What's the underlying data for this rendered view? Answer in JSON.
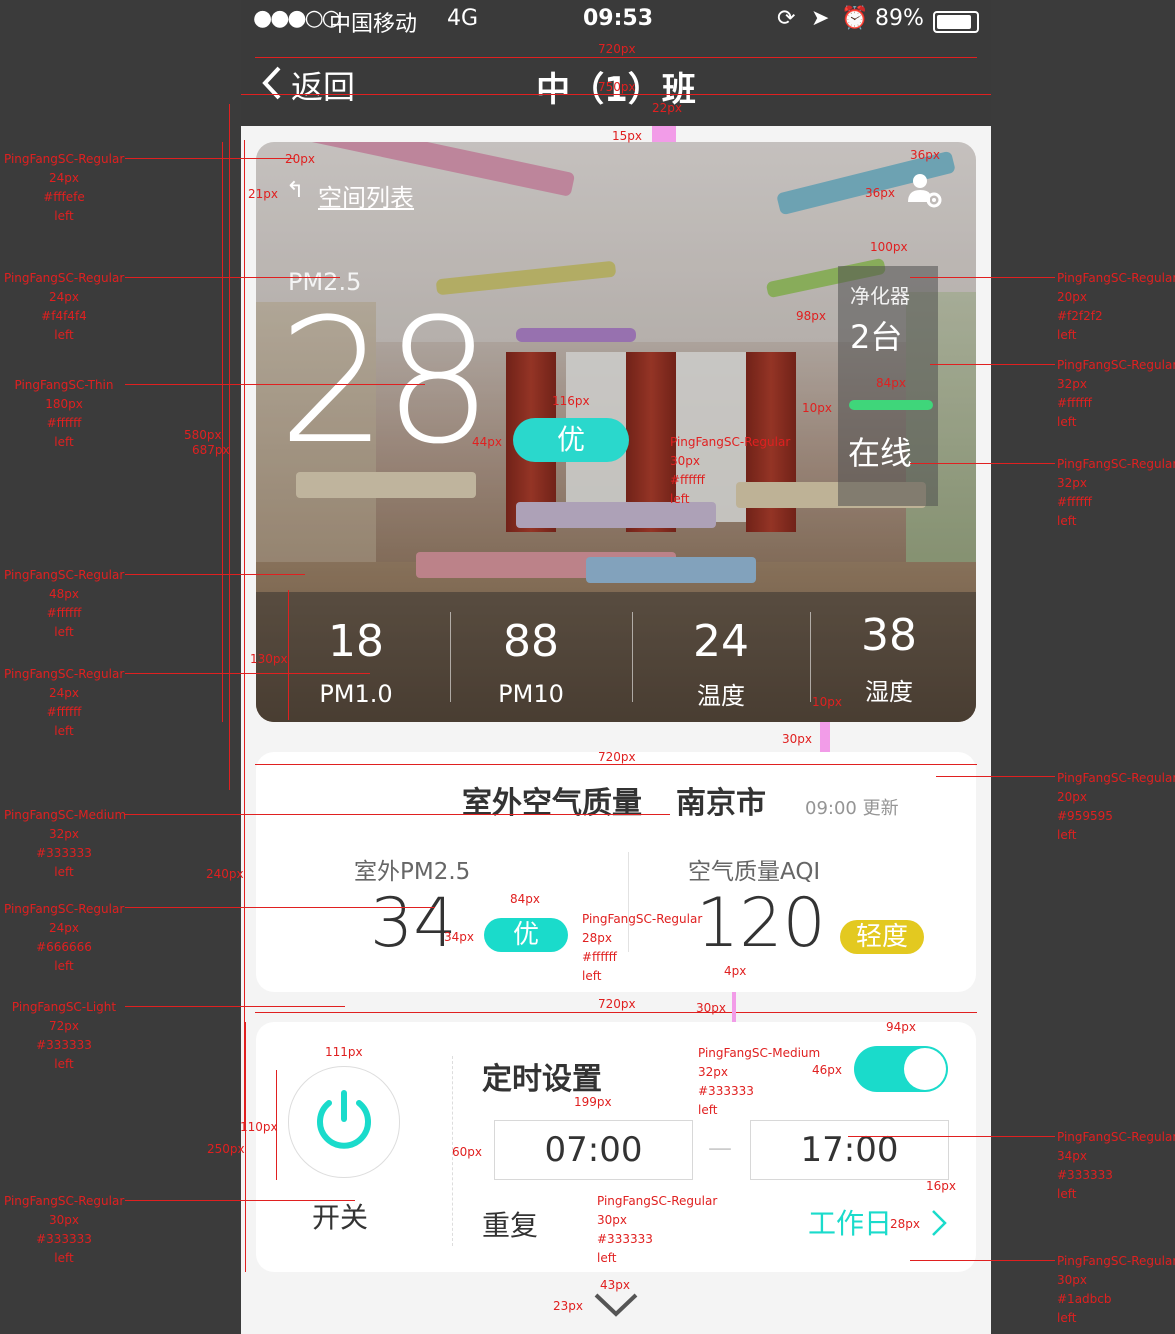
{
  "status_bar": {
    "signal": "●●●○○",
    "carrier": "中国移动",
    "network": "4G",
    "time": "09:53",
    "battery": "89%"
  },
  "nav": {
    "back_label": "返回",
    "title": "中（1）班"
  },
  "hero": {
    "space_list_label": "空间列表",
    "pm25_label": "PM2.5",
    "pm25_value": "28",
    "quality_badge": "优",
    "purifier_label": "净化器",
    "purifier_count": "2台",
    "purifier_status": "在线",
    "metrics": [
      {
        "value": "18",
        "label": "PM1.0"
      },
      {
        "value": "88",
        "label": "PM10"
      },
      {
        "value": "24",
        "label": "温度"
      },
      {
        "value": "38",
        "label": "湿度"
      }
    ]
  },
  "outdoor": {
    "title": "室外空气质量",
    "city": "南京市",
    "updated": "09:00 更新",
    "pm25_label": "室外PM2.5",
    "pm25_value": "34",
    "pm25_badge": "优",
    "aqi_label": "空气质量AQI",
    "aqi_value": "120",
    "aqi_badge": "轻度",
    "colors": {
      "good": "#1adbcb",
      "light": "#e3c920"
    }
  },
  "timer": {
    "power_label": "开关",
    "title": "定时设置",
    "toggle_on": true,
    "start_time": "07:00",
    "separator": "—",
    "end_time": "17:00",
    "repeat_label": "重复",
    "repeat_value": "工作日",
    "accent": "#1adbcb"
  },
  "annotations": {
    "widths": {
      "w720a": "720px",
      "w750": "750px",
      "w22": "22px",
      "w15": "15px",
      "w20": "20px",
      "w21": "21px",
      "w36a": "36px",
      "w36b": "36px",
      "w100": "100px",
      "w98": "98px",
      "w84a": "84px",
      "w10a": "10px",
      "w116": "116px",
      "w44": "44px",
      "w580": "580px",
      "w687": "687px",
      "w130": "130px",
      "w10b": "10px",
      "w30a": "30px",
      "w720b": "720px",
      "w240": "240px",
      "w84b": "84px",
      "w34": "34px",
      "w4": "4px",
      "w720c": "720px",
      "w30b": "30px",
      "w94": "94px",
      "w46": "46px",
      "w111": "111px",
      "w199": "199px",
      "w110": "110px",
      "w250": "250px",
      "w60": "60px",
      "w16": "16px",
      "w28": "28px",
      "w43": "43px",
      "w23": "23px"
    },
    "left_specs": [
      {
        "font": "PingFangSC-Regular",
        "size": "24px",
        "color": "#fffefe",
        "align": "left"
      },
      {
        "font": "PingFangSC-Regular",
        "size": "24px",
        "color": "#f4f4f4",
        "align": "left"
      },
      {
        "font": "PingFangSC-Thin",
        "size": "180px",
        "color": "#ffffff",
        "align": "left"
      },
      {
        "font": "PingFangSC-Regular",
        "size": "48px",
        "color": "#ffffff",
        "align": "left"
      },
      {
        "font": "PingFangSC-Regular",
        "size": "24px",
        "color": "#ffffff",
        "align": "left"
      },
      {
        "font": "PingFangSC-Medium",
        "size": "32px",
        "color": "#333333",
        "align": "left"
      },
      {
        "font": "PingFangSC-Regular",
        "size": "24px",
        "color": "#666666",
        "align": "left"
      },
      {
        "font": "PingFangSC-Light",
        "size": "72px",
        "color": "#333333",
        "align": "left"
      },
      {
        "font": "PingFangSC-Regular",
        "size": "30px",
        "color": "#333333",
        "align": "left"
      }
    ],
    "right_specs": [
      {
        "font": "PingFangSC-Regular",
        "size": "20px",
        "color": "#f2f2f2",
        "align": "left"
      },
      {
        "font": "PingFangSC-Regular",
        "size": "32px",
        "color": "#ffffff",
        "align": "left"
      },
      {
        "font": "PingFangSC-Regular",
        "size": "32px",
        "color": "#ffffff",
        "align": "left"
      },
      {
        "font": "PingFangSC-Regular",
        "size": "20px",
        "color": "#959595",
        "align": "left"
      },
      {
        "font": "PingFangSC-Regular",
        "size": "34px",
        "color": "#333333",
        "align": "left"
      },
      {
        "font": "PingFangSC-Regular",
        "size": "30px",
        "color": "#1adbcb",
        "align": "left"
      }
    ],
    "inline_specs": [
      {
        "font": "PingFangSC-Regular",
        "size": "30px",
        "color": "#ffffff",
        "align": "left"
      },
      {
        "font": "PingFangSC-Regular",
        "size": "28px",
        "color": "#ffffff",
        "align": "left"
      },
      {
        "font": "PingFangSC-Medium",
        "size": "32px",
        "color": "#333333",
        "align": "left"
      },
      {
        "font": "PingFangSC-Regular",
        "size": "30px",
        "color": "#333333",
        "align": "left"
      }
    ]
  }
}
